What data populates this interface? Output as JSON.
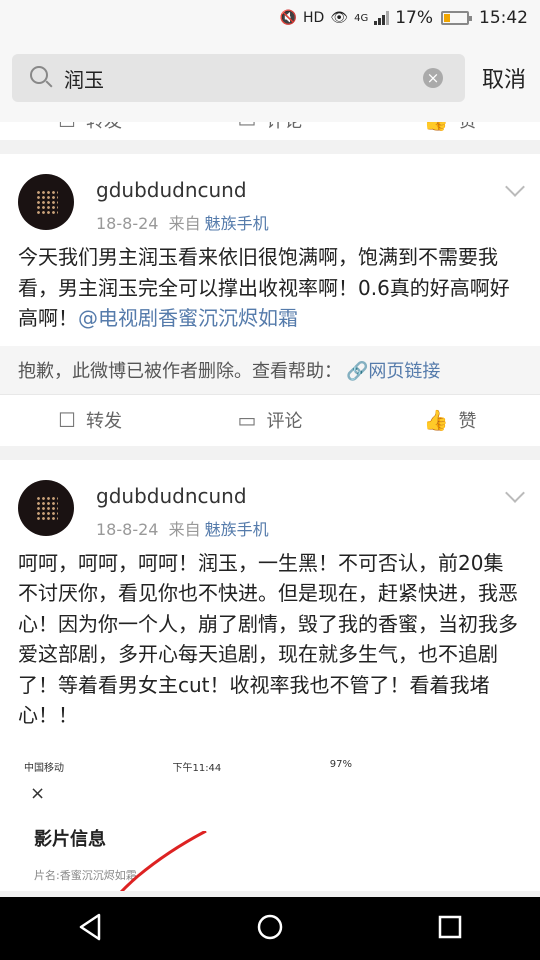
{
  "status": {
    "battery": "17%",
    "time": "15:42",
    "hd": "HD",
    "net": "4G"
  },
  "search": {
    "query": "润玉",
    "cancel": "取消"
  },
  "actions": {
    "repost": "转发",
    "comment": "评论",
    "like": "赞"
  },
  "posts": [
    {
      "username": "gdubdudncund",
      "date": "18-8-24",
      "from": "来自",
      "source": "魅族手机",
      "text": "今天我们男主润玉看来依旧很饱满啊，饱满到不需要我看，男主润玉完全可以撑出收视率啊！0.6真的好高啊好高啊！",
      "mention": "@电视剧香蜜沉沉烬如霜",
      "deleted": "抱歉，此微博已被作者删除。查看帮助：",
      "link": "网页链接"
    },
    {
      "username": "gdubdudncund",
      "date": "18-8-24",
      "from": "来自",
      "source": "魅族手机",
      "text": "呵呵，呵呵，呵呵！润玉，一生黑！不可否认，前20集不讨厌你，看见你也不快进。但是现在，赶紧快进，我恶心！因为你一个人，崩了剧情，毁了我的香蜜，当初我多爱这部剧，多开心每天追剧，现在就多生气，也不追剧了！等着看男女主cut！收视率我也不管了！看着我堵心！！"
    }
  ],
  "embed": {
    "carrier": "中国移动",
    "time": "下午11:44",
    "battery": "97%",
    "close": "×",
    "title": "影片信息",
    "sub": "片名:香蜜沉沉烬如霜"
  },
  "colors": {
    "link": "#557bab",
    "battery": "#f0a500"
  }
}
